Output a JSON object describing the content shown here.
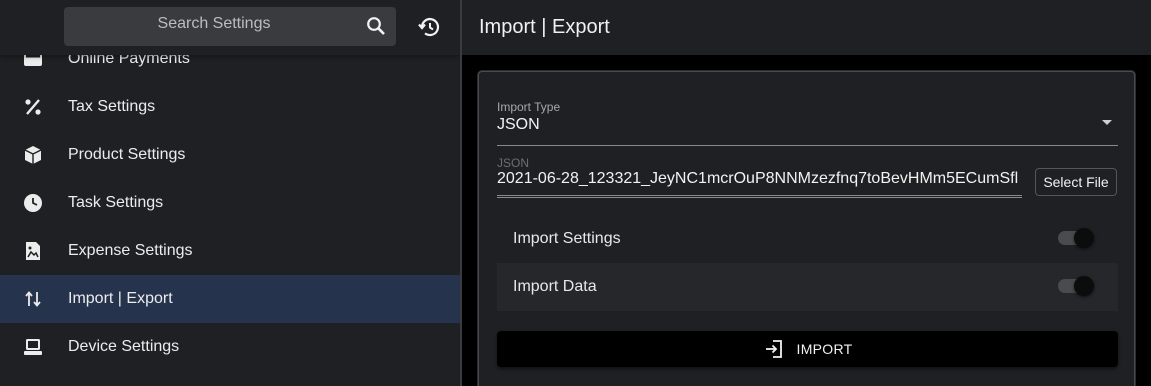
{
  "search": {
    "placeholder": "Search Settings"
  },
  "sidebar": {
    "items": [
      {
        "label": "Online Payments",
        "icon": "credit-card-icon"
      },
      {
        "label": "Tax Settings",
        "icon": "percent-icon"
      },
      {
        "label": "Product Settings",
        "icon": "cube-icon"
      },
      {
        "label": "Task Settings",
        "icon": "clock-icon"
      },
      {
        "label": "Expense Settings",
        "icon": "receipt-image-icon"
      },
      {
        "label": "Import | Export",
        "icon": "swap-vertical-icon",
        "active": true
      },
      {
        "label": "Device Settings",
        "icon": "device-icon"
      }
    ]
  },
  "header": {
    "title": "Import | Export"
  },
  "form": {
    "import_type_label": "Import Type",
    "import_type_value": "JSON",
    "json_label": "JSON",
    "json_value": "2021-06-28_123321_JeyNC1mcrOuP8NNMzezfnq7toBevHMm5ECumSfl",
    "select_file_label": "Select File",
    "toggles": [
      {
        "label": "Import Settings",
        "on": true
      },
      {
        "label": "Import Data",
        "on": true
      }
    ],
    "import_button_label": "IMPORT"
  },
  "colors": {
    "sidebar_bg": "#1f2023",
    "active_item_bg": "#25334d",
    "page_bg": "#000000",
    "card_bg": "#1f2023"
  }
}
